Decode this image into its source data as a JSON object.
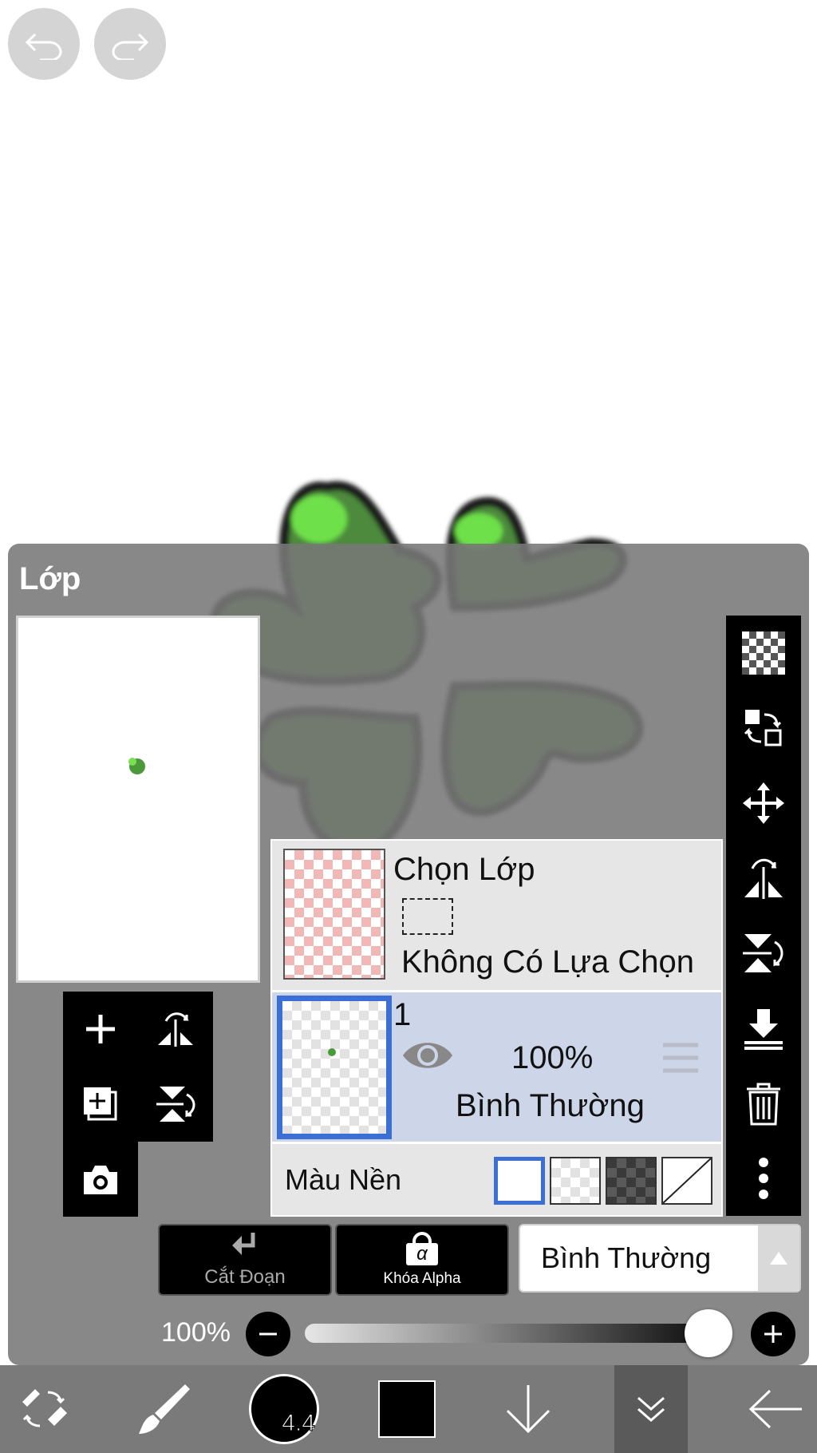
{
  "colors": {
    "panel": "#787878",
    "selected_layer_border": "#3c6fd6",
    "selected_layer_bg": "#cdd5e8",
    "leaf_green": "#4a7f3a"
  },
  "top": {
    "undo_icon": "undo-icon",
    "redo_icon": "redo-icon"
  },
  "panel": {
    "title": "Lớp"
  },
  "selection_row": {
    "title": "Chọn Lớp",
    "subtitle": "Không Có Lựa Chọn"
  },
  "layer": {
    "name": "1",
    "opacity": "100%",
    "blend": "Bình Thường",
    "visible": true
  },
  "background_row": {
    "label": "Màu Nền",
    "options": [
      "white",
      "transparent",
      "dark",
      "none"
    ],
    "selected": "white"
  },
  "actions": {
    "clip_label": "Cắt Đoạn",
    "alpha_lock_label": "Khóa Alpha",
    "alpha_symbol": "α",
    "blend_mode": "Bình Thường"
  },
  "opacity_slider": {
    "label": "100%",
    "value": 1.0
  },
  "bottom_toolbar": {
    "brush_size": "4.4"
  }
}
